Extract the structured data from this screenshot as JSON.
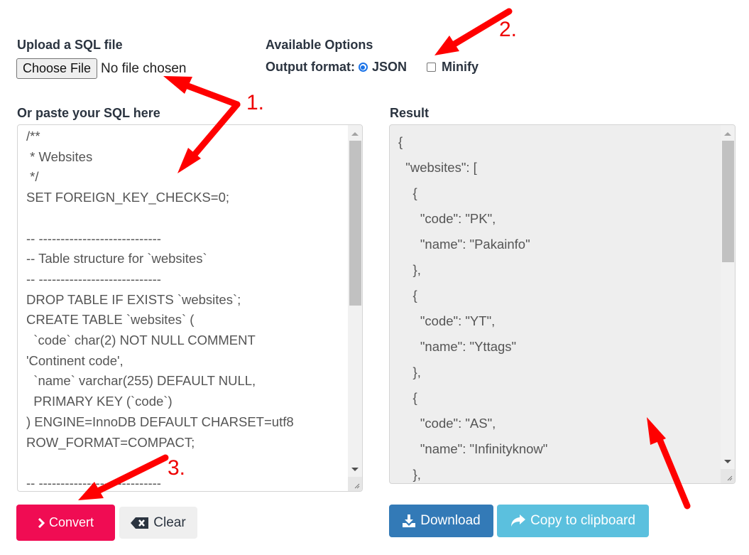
{
  "upload": {
    "label": "Upload a SQL file",
    "choose_button": "Choose File",
    "status": "No file chosen"
  },
  "options": {
    "label": "Available Options",
    "output_format_label": "Output format:",
    "format_option": "JSON",
    "format_selected": true,
    "minify_label": "Minify",
    "minify_checked": false
  },
  "sql_input": {
    "label": "Or paste your SQL here",
    "lines": [
      "/**",
      " * Websites",
      " */",
      "SET FOREIGN_KEY_CHECKS=0;",
      "",
      "-- ----------------------------",
      "-- Table structure for `websites`",
      "-- ----------------------------",
      "DROP TABLE IF EXISTS `websites`;",
      "CREATE TABLE `websites` (",
      "  `code` char(2) NOT NULL COMMENT",
      "'Continent code',",
      "  `name` varchar(255) DEFAULT NULL,",
      "  PRIMARY KEY (`code`)",
      ") ENGINE=InnoDB DEFAULT CHARSET=utf8",
      "ROW_FORMAT=COMPACT;",
      "",
      "-- ----------------------------"
    ]
  },
  "result": {
    "label": "Result",
    "lines": [
      "{",
      "  \"websites\": [",
      "    {",
      "      \"code\": \"PK\",",
      "      \"name\": \"Pakainfo\"",
      "    },",
      "    {",
      "      \"code\": \"YT\",",
      "      \"name\": \"Yttags\"",
      "    },",
      "    {",
      "      \"code\": \"AS\",",
      "      \"name\": \"Infinityknow\"",
      "    },"
    ]
  },
  "buttons": {
    "convert": "Convert",
    "clear": "Clear",
    "download": "Download",
    "copy": "Copy to clipboard"
  },
  "annotations": {
    "step1": "1.",
    "step2": "2.",
    "step3": "3."
  },
  "colors": {
    "convert": "#f00c53",
    "download": "#337ab7",
    "copy": "#5bc0de",
    "annotation": "#ee0000"
  }
}
